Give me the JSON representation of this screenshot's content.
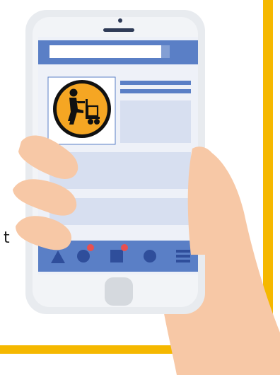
{
  "fragment_text": "t",
  "colors": {
    "frame_border": "#f5b800",
    "phone_body": "#e8ebef",
    "phone_screen_bg": "#eef1f8",
    "app_bar": "#5a7fc6",
    "search_field": "#ffffff",
    "placeholder_block": "#d7dff0",
    "accent_dot": "#e8504f",
    "skin": "#f7c8a6",
    "icon_badge": "#f5a623"
  },
  "icons": [
    "hand-truck-worker-icon",
    "triangle-nav-icon",
    "circle-nav-icon",
    "square-nav-icon",
    "dot-nav-icon",
    "menu-icon",
    "home-button-icon",
    "speaker-icon"
  ],
  "notification_badges": 2
}
